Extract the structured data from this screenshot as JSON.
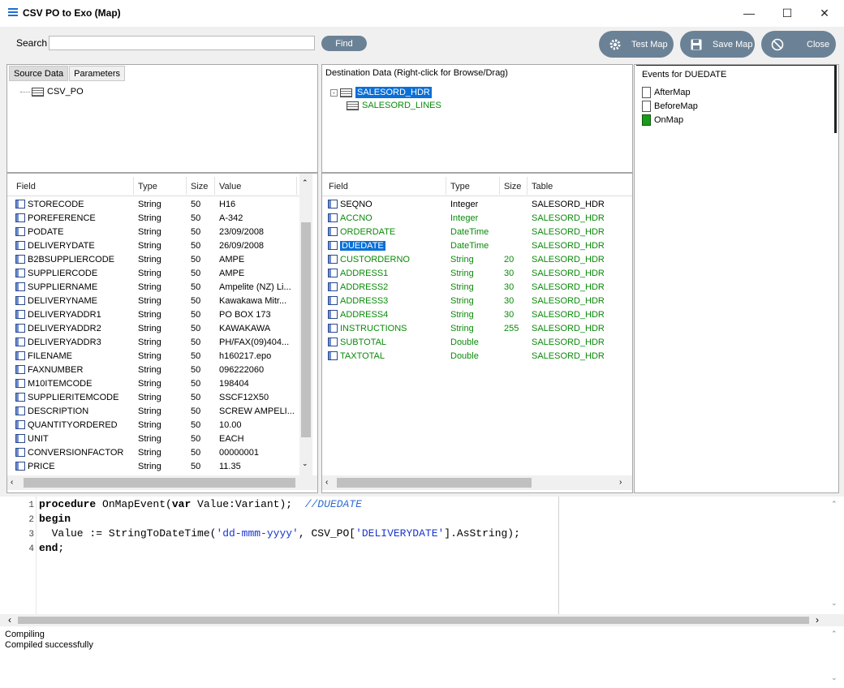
{
  "window": {
    "title": "CSV PO to Exo (Map)"
  },
  "search": {
    "label": "Search",
    "value": "",
    "placeholder": "",
    "find_label": "Find"
  },
  "toolbar": {
    "test_map": "Test Map",
    "save_map": "Save Map",
    "close": "Close"
  },
  "source": {
    "tabs": [
      {
        "label": "Source Data",
        "active": true
      },
      {
        "label": "Parameters",
        "active": false
      }
    ],
    "tree": [
      {
        "label": "CSV_PO"
      }
    ],
    "columns": [
      "Field",
      "Type",
      "Size",
      "Value"
    ],
    "rows": [
      {
        "field": "STORECODE",
        "type": "String",
        "size": "50",
        "value": "H16"
      },
      {
        "field": "POREFERENCE",
        "type": "String",
        "size": "50",
        "value": "A-342"
      },
      {
        "field": "PODATE",
        "type": "String",
        "size": "50",
        "value": "23/09/2008"
      },
      {
        "field": "DELIVERYDATE",
        "type": "String",
        "size": "50",
        "value": "26/09/2008"
      },
      {
        "field": "B2BSUPPLIERCODE",
        "type": "String",
        "size": "50",
        "value": "AMPE"
      },
      {
        "field": "SUPPLIERCODE",
        "type": "String",
        "size": "50",
        "value": "AMPE"
      },
      {
        "field": "SUPPLIERNAME",
        "type": "String",
        "size": "50",
        "value": "Ampelite (NZ) Li..."
      },
      {
        "field": "DELIVERYNAME",
        "type": "String",
        "size": "50",
        "value": "Kawakawa Mitr..."
      },
      {
        "field": "DELIVERYADDR1",
        "type": "String",
        "size": "50",
        "value": "PO BOX 173"
      },
      {
        "field": "DELIVERYADDR2",
        "type": "String",
        "size": "50",
        "value": "KAWAKAWA"
      },
      {
        "field": "DELIVERYADDR3",
        "type": "String",
        "size": "50",
        "value": "PH/FAX(09)404..."
      },
      {
        "field": "FILENAME",
        "type": "String",
        "size": "50",
        "value": "h160217.epo"
      },
      {
        "field": "FAXNUMBER",
        "type": "String",
        "size": "50",
        "value": "096222060"
      },
      {
        "field": "M10ITEMCODE",
        "type": "String",
        "size": "50",
        "value": "198404"
      },
      {
        "field": "SUPPLIERITEMCODE",
        "type": "String",
        "size": "50",
        "value": "SSCF12X50"
      },
      {
        "field": "DESCRIPTION",
        "type": "String",
        "size": "50",
        "value": "SCREW AMPELI..."
      },
      {
        "field": "QUANTITYORDERED",
        "type": "String",
        "size": "50",
        "value": "10.00"
      },
      {
        "field": "UNIT",
        "type": "String",
        "size": "50",
        "value": "EACH"
      },
      {
        "field": "CONVERSIONFACTOR",
        "type": "String",
        "size": "50",
        "value": "00000001"
      },
      {
        "field": "PRICE",
        "type": "String",
        "size": "50",
        "value": "11.35"
      }
    ]
  },
  "destination": {
    "header": "Destination Data  (Right-click for Browse/Drag)",
    "tree": [
      {
        "label": "SALESORD_HDR",
        "selected": true
      },
      {
        "label": "SALESORD_LINES",
        "selected": false
      }
    ],
    "columns": [
      "Field",
      "Type",
      "Size",
      "Table"
    ],
    "rows": [
      {
        "field": "SEQNO",
        "type": "Integer",
        "size": "",
        "table": "SALESORD_HDR",
        "green": false,
        "selected": false
      },
      {
        "field": "ACCNO",
        "type": "Integer",
        "size": "",
        "table": "SALESORD_HDR",
        "green": true,
        "selected": false
      },
      {
        "field": "ORDERDATE",
        "type": "DateTime",
        "size": "",
        "table": "SALESORD_HDR",
        "green": true,
        "selected": false
      },
      {
        "field": "DUEDATE",
        "type": "DateTime",
        "size": "",
        "table": "SALESORD_HDR",
        "green": true,
        "selected": true
      },
      {
        "field": "CUSTORDERNO",
        "type": "String",
        "size": "20",
        "table": "SALESORD_HDR",
        "green": true,
        "selected": false
      },
      {
        "field": "ADDRESS1",
        "type": "String",
        "size": "30",
        "table": "SALESORD_HDR",
        "green": true,
        "selected": false
      },
      {
        "field": "ADDRESS2",
        "type": "String",
        "size": "30",
        "table": "SALESORD_HDR",
        "green": true,
        "selected": false
      },
      {
        "field": "ADDRESS3",
        "type": "String",
        "size": "30",
        "table": "SALESORD_HDR",
        "green": true,
        "selected": false
      },
      {
        "field": "ADDRESS4",
        "type": "String",
        "size": "30",
        "table": "SALESORD_HDR",
        "green": true,
        "selected": false
      },
      {
        "field": "INSTRUCTIONS",
        "type": "String",
        "size": "255",
        "table": "SALESORD_HDR",
        "green": true,
        "selected": false
      },
      {
        "field": "SUBTOTAL",
        "type": "Double",
        "size": "",
        "table": "SALESORD_HDR",
        "green": true,
        "selected": false
      },
      {
        "field": "TAXTOTAL",
        "type": "Double",
        "size": "",
        "table": "SALESORD_HDR",
        "green": true,
        "selected": false
      }
    ]
  },
  "events": {
    "header": "Events for DUEDATE",
    "items": [
      {
        "label": "AfterMap",
        "active": false
      },
      {
        "label": "BeforeMap",
        "active": false
      },
      {
        "label": "OnMap",
        "active": true
      }
    ]
  },
  "editor": {
    "line_numbers": [
      "1",
      "2",
      "3",
      "4"
    ],
    "lines": [
      [
        {
          "t": "procedure",
          "c": "kw"
        },
        {
          "t": " OnMapEvent(",
          "c": ""
        },
        {
          "t": "var",
          "c": "kw"
        },
        {
          "t": " Value:Variant);  ",
          "c": ""
        },
        {
          "t": "//DUEDATE",
          "c": "cmt"
        }
      ],
      [
        {
          "t": "begin",
          "c": "kw"
        }
      ],
      [
        {
          "t": "  Value := StringToDateTime(",
          "c": ""
        },
        {
          "t": "'dd-mmm-yyyy'",
          "c": "str"
        },
        {
          "t": ", CSV_PO[",
          "c": ""
        },
        {
          "t": "'DELIVERYDATE'",
          "c": "str"
        },
        {
          "t": "].AsString);",
          "c": ""
        }
      ],
      [
        {
          "t": "end",
          "c": "kw"
        },
        {
          "t": ";",
          "c": ""
        }
      ]
    ]
  },
  "output": {
    "lines": [
      "Compiling",
      "Compiled successfully"
    ]
  }
}
